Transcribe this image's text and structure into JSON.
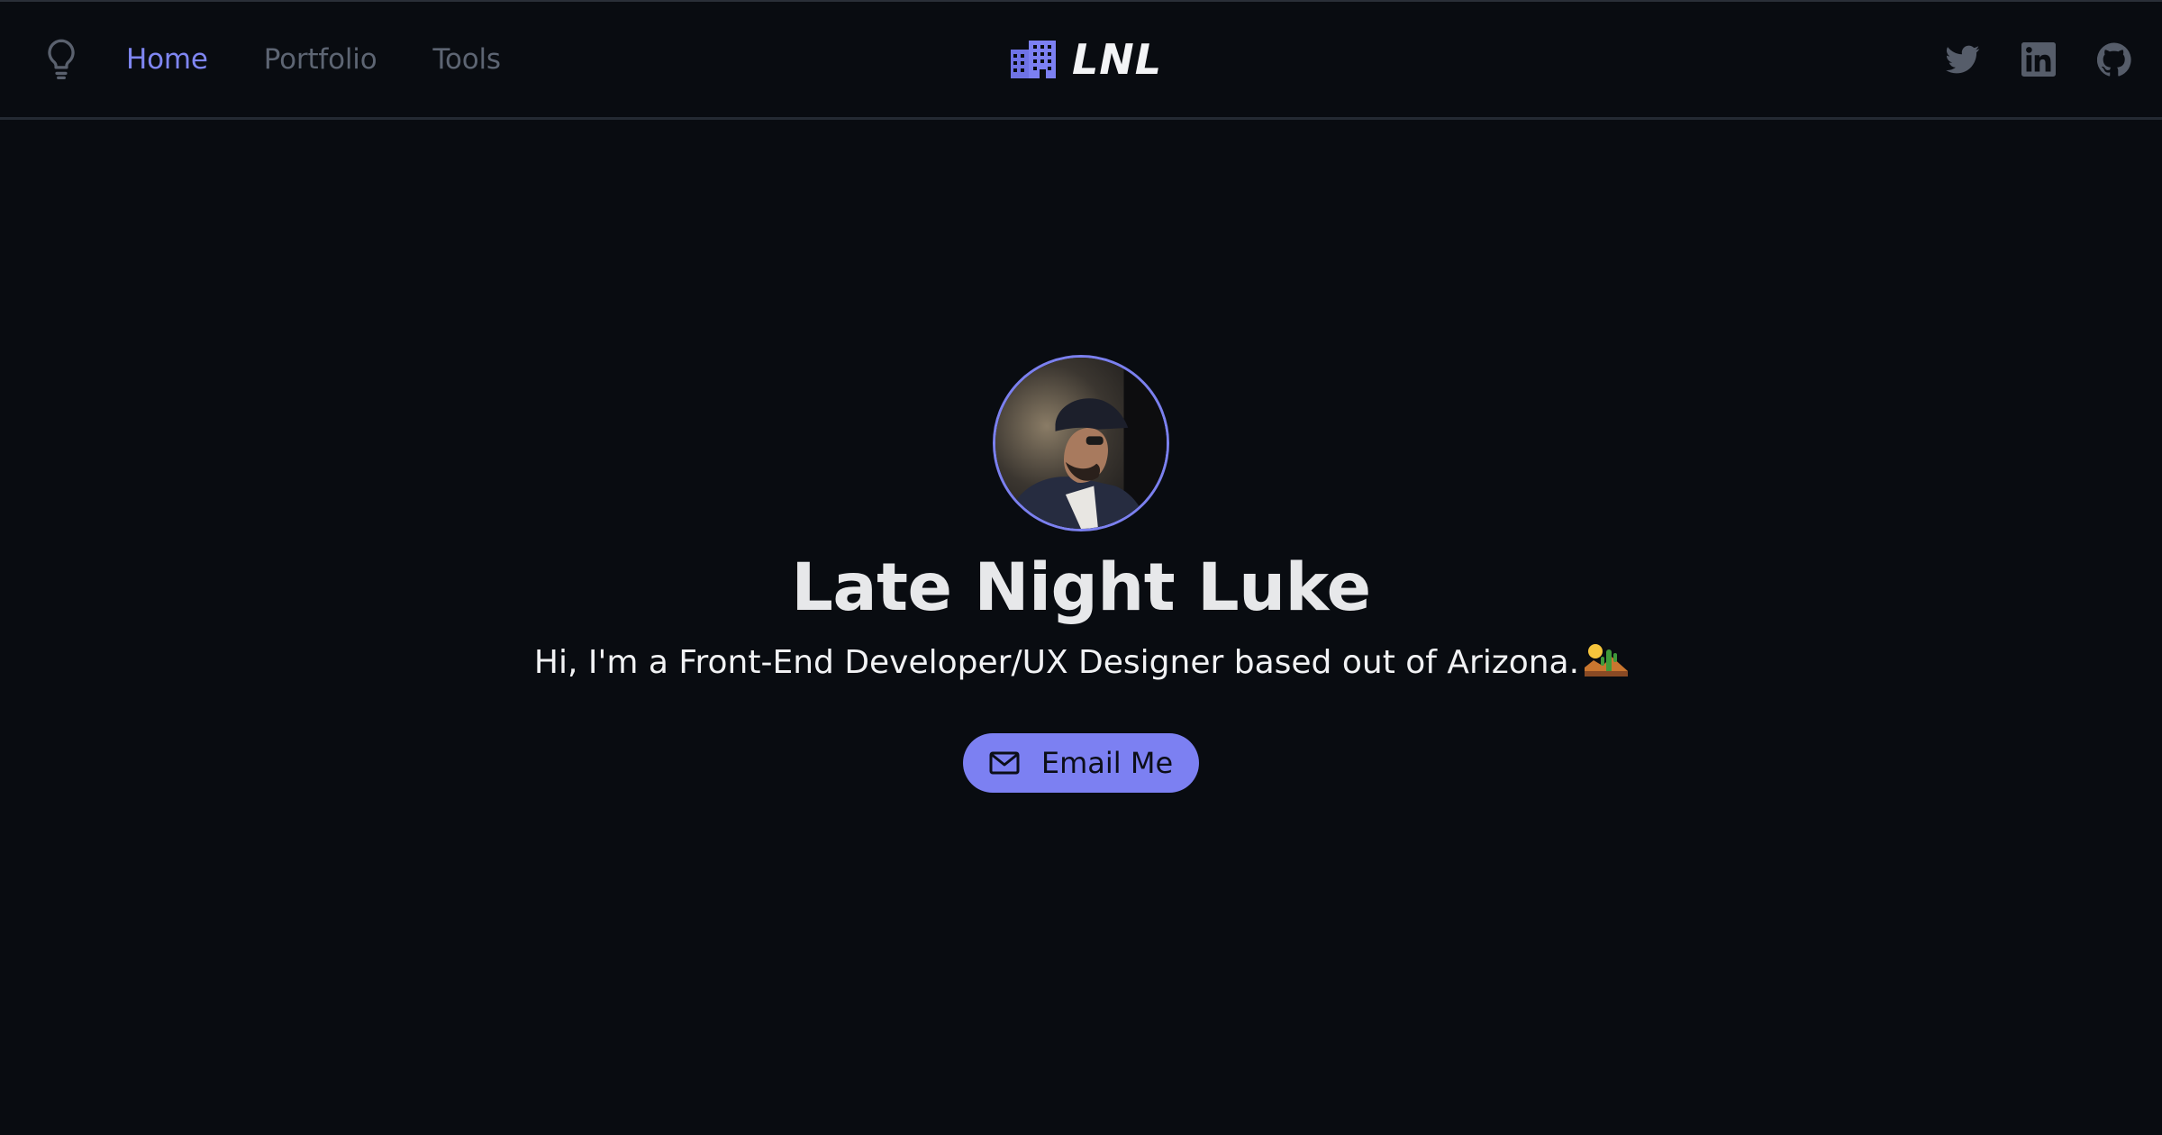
{
  "nav": {
    "theme_toggle_icon": "lightbulb-icon",
    "links": [
      {
        "label": "Home",
        "active": true
      },
      {
        "label": "Portfolio",
        "active": false
      },
      {
        "label": "Tools",
        "active": false
      }
    ],
    "brand": {
      "icon": "building-icon",
      "text": "LNL"
    },
    "socials": [
      {
        "icon": "twitter-icon"
      },
      {
        "icon": "linkedin-icon"
      },
      {
        "icon": "github-icon"
      }
    ]
  },
  "hero": {
    "avatar_icon": "profile-photo",
    "name": "Late Night Luke",
    "tagline": "Hi, I'm a Front-End Developer/UX Designer based out of Arizona.",
    "tagline_emoji": "desert-icon",
    "cta": {
      "icon": "mail-icon",
      "label": "Email Me"
    }
  },
  "colors": {
    "background": "#090c11",
    "accent": "#7c80f2",
    "nav_inactive": "#5d6573",
    "text": "#e7e8ea"
  }
}
